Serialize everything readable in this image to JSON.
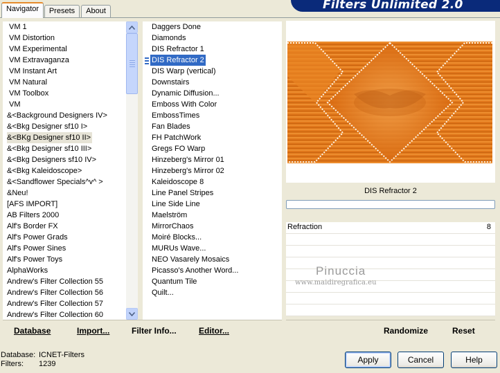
{
  "tabs": [
    "Navigator",
    "Presets",
    "About"
  ],
  "app_title": "Filters Unlimited 2.0",
  "categories": {
    "items": [
      "VM 1",
      "VM Distortion",
      "VM Experimental",
      "VM Extravaganza",
      "VM Instant Art",
      "VM Natural",
      "VM Toolbox",
      "VM",
      "&<Background Designers IV>",
      "&<Bkg Designer sf10 I>",
      "&<BKg Designer sf10 II>",
      "&<Bkg Designer sf10 III>",
      "&<Bkg Designers sf10 IV>",
      "&<Bkg Kaleidoscope>",
      "&<Sandflower Specials^v^ >",
      "&Neu!",
      "[AFS IMPORT]",
      "AB Filters 2000",
      "Alf's Border FX",
      "Alf's Power Grads",
      "Alf's Power Sines",
      "Alf's Power Toys",
      "AlphaWorks",
      "Andrew's Filter Collection 55",
      "Andrew's Filter Collection 56",
      "Andrew's Filter Collection 57",
      "Andrew's Filter Collection 60"
    ],
    "selected_index": 10
  },
  "filters": {
    "items": [
      "Daggers Done",
      "Diamonds",
      "DIS Refractor 1",
      "DIS Refractor 2",
      "DIS Warp (vertical)",
      "Downstairs",
      "Dynamic Diffusion...",
      "Emboss With Color",
      "EmbossTimes",
      "Fan Blades",
      "FH PatchWork",
      "Gregs FO Warp",
      "Hinzeberg's Mirror 01",
      "Hinzeberg's Mirror 02",
      "Kaleidoscope 8",
      "Line Panel Stripes",
      "Line Side Line",
      "Maelström",
      "MirrorChaos",
      "Moiré Blocks...",
      "MURUs Wave...",
      "NEO Vasarely Mosaics",
      "Picasso's Another Word...",
      "Quantum Tile",
      "Quilt..."
    ],
    "selected_index": 3
  },
  "selected_filter_name": "DIS Refractor 2",
  "parameters": [
    {
      "label": "Refraction",
      "value": "8",
      "fraction": 0.03
    }
  ],
  "watermark": {
    "line1": "Pinuccia",
    "line2": "www.maidiregrafica.eu"
  },
  "left_buttons": {
    "database": "Database",
    "import": "Import...",
    "filter_info": "Filter Info...",
    "editor": "Editor..."
  },
  "right_buttons": {
    "randomize": "Randomize",
    "reset": "Reset"
  },
  "status": {
    "db_label": "Database:",
    "db_value": "ICNET-Filters",
    "filters_label": "Filters:",
    "filters_value": "1239"
  },
  "dialog_buttons": {
    "apply": "Apply",
    "cancel": "Cancel",
    "help": "Help"
  },
  "colors": {
    "selection_blue": "#316ac5",
    "banner": "#0a2a7a",
    "preview_orange": "#e07a1c"
  }
}
